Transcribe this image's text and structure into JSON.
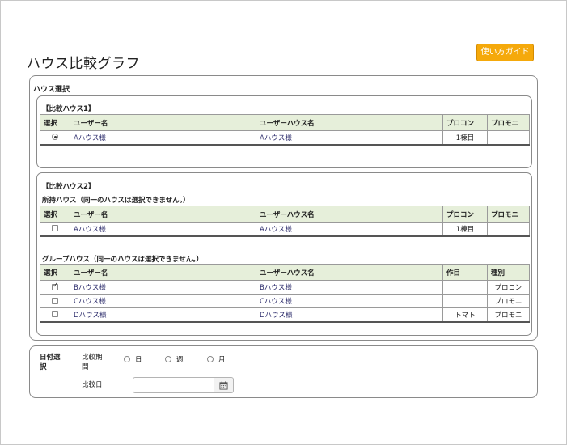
{
  "page": {
    "title": "ハウス比較グラフ",
    "guide_button": "使い方ガイド"
  },
  "house_select": {
    "title": "ハウス選択",
    "compare1": {
      "title": "【比較ハウス1】",
      "headers": [
        "選択",
        "ユーザー名",
        "ユーザーハウス名",
        "プロコン",
        "プロモニ"
      ],
      "rows": [
        {
          "selected": true,
          "user": "Aハウス様",
          "house": "Aハウス様",
          "procon": "1棟目",
          "promoni": ""
        }
      ]
    },
    "compare2": {
      "title": "【比較ハウス2】",
      "owned": {
        "title": "所持ハウス（同一のハウスは選択できません。）",
        "headers": [
          "選択",
          "ユーザー名",
          "ユーザーハウス名",
          "プロコン",
          "プロモニ"
        ],
        "rows": [
          {
            "checked": false,
            "user": "Aハウス様",
            "house": "Aハウス様",
            "col3": "1棟目",
            "col4": ""
          }
        ]
      },
      "group": {
        "title": "グループハウス（同一のハウスは選択できません。）",
        "headers": [
          "選択",
          "ユーザー名",
          "ユーザーハウス名",
          "作目",
          "種別"
        ],
        "rows": [
          {
            "checked": true,
            "user": "Bハウス様",
            "house": "Bハウス様",
            "crop": "",
            "type": "プロコン"
          },
          {
            "checked": false,
            "user": "Cハウス様",
            "house": "Cハウス様",
            "crop": "",
            "type": "プロモニ"
          },
          {
            "checked": false,
            "user": "Dハウス様",
            "house": "Dハウス様",
            "crop": "トマト",
            "type": "プロモニ"
          }
        ]
      }
    }
  },
  "date_select": {
    "title": "日付選択",
    "period_label": "比較期間",
    "period_options": [
      "日",
      "週",
      "月"
    ],
    "date_label": "比較日",
    "date_value": ""
  }
}
